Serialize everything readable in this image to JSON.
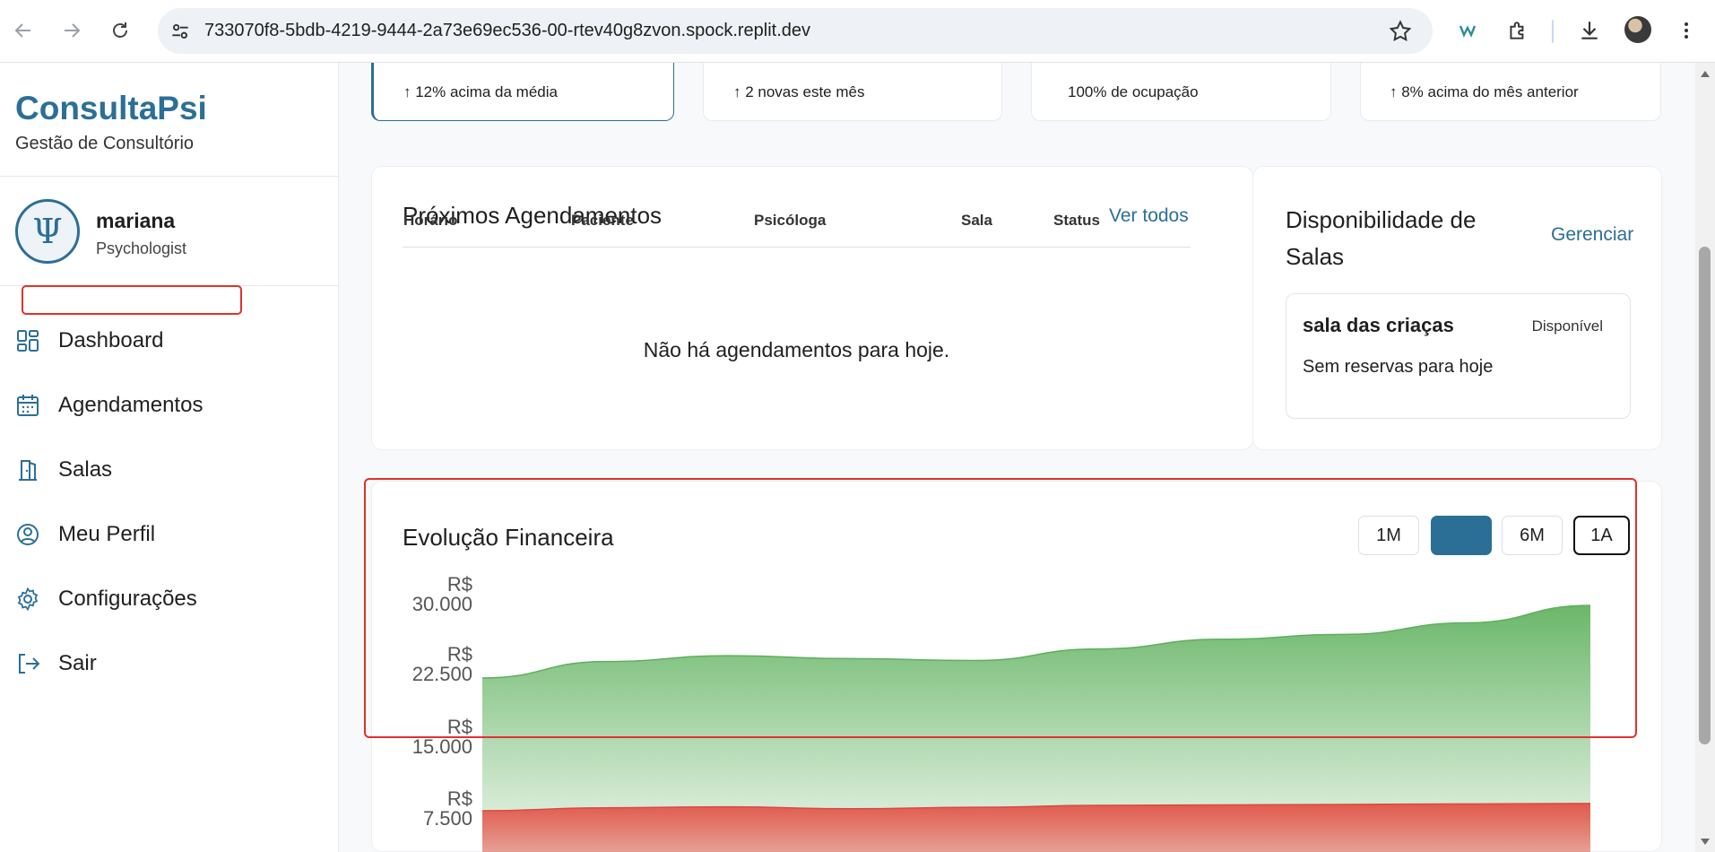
{
  "browser": {
    "url": "733070f8-5bdb-4219-9444-2a73e69ec536-00-rtev40g8zvon.spock.replit.dev",
    "icons": [
      "back-icon",
      "forward-icon",
      "reload-icon",
      "site-info-icon",
      "bookmark-star-icon",
      "w-extension-icon",
      "extensions-puzzle-icon",
      "download-icon",
      "profile-avatar",
      "more-menu-icon"
    ]
  },
  "sidebar": {
    "brand": "ConsultaPsi",
    "subtitle": "Gestão de Consultório",
    "user": {
      "avatar_glyph": "Ψ",
      "name": "mariana",
      "role": "Psychologist"
    },
    "menu": [
      {
        "label": "Dashboard",
        "icon": "dashboard-grid-icon"
      },
      {
        "label": "Agendamentos",
        "icon": "calendar-icon"
      },
      {
        "label": "Salas",
        "icon": "door-icon"
      },
      {
        "label": "Meu Perfil",
        "icon": "user-circle-icon"
      },
      {
        "label": "Configurações",
        "icon": "gear-icon"
      },
      {
        "label": "Sair",
        "icon": "logout-icon"
      }
    ]
  },
  "stats": [
    {
      "text": "↑ 12% acima da média"
    },
    {
      "text": "↑ 2 novas este mês"
    },
    {
      "text": "100% de ocupação"
    },
    {
      "text": "↑ 8% acima do mês anterior"
    }
  ],
  "appointments": {
    "title": "Próximos Agendamentos",
    "link": "Ver todos",
    "columns": [
      "Horário",
      "Paciente",
      "Psicóloga",
      "Sala",
      "Status"
    ],
    "empty_message": "Não há agendamentos para hoje."
  },
  "rooms": {
    "title": "Disponibilidade de Salas",
    "link": "Gerenciar",
    "items": [
      {
        "name": "sala das criaças",
        "status": "Disponível",
        "description": "Sem reservas para hoje"
      }
    ]
  },
  "finance": {
    "title": "Evolução Financeira",
    "periods": [
      "1M",
      "",
      "6M",
      "1A"
    ]
  },
  "chart_data": {
    "type": "area",
    "title": "Evolução Financeira",
    "y_ticks": [
      "R$ 30.000",
      "R$ 22.500",
      "R$ 15.000",
      "R$ 7.500"
    ],
    "ylim": [
      0,
      30000
    ],
    "series": [
      {
        "values": [
          22500,
          24200,
          24800,
          24500,
          24300,
          25500,
          26500,
          27000,
          28200,
          30000
        ],
        "color": "#6bb76a"
      },
      {
        "values": [
          8800,
          9100,
          9200,
          9000,
          9150,
          9350,
          9400,
          9450,
          9500,
          9550
        ],
        "color": "#e25a4e"
      }
    ]
  },
  "colors": {
    "accent": "#2b6f96",
    "highlight": "#e0312f"
  }
}
